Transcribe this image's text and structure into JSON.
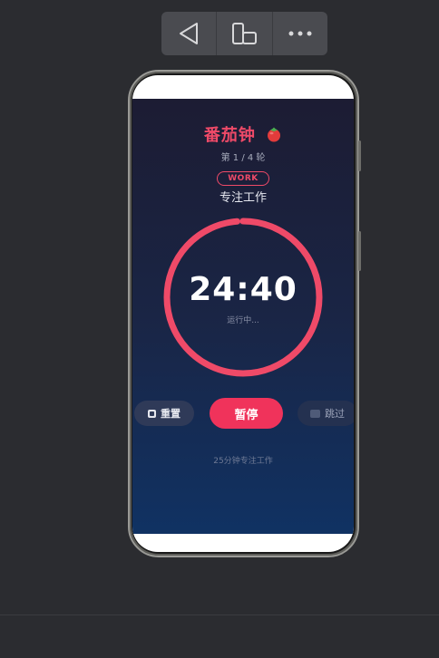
{
  "toolbar": {
    "buttons": [
      {
        "icon": "back-triangle-icon"
      },
      {
        "icon": "device-rotate-icon"
      },
      {
        "icon": "more-dots-icon"
      }
    ]
  },
  "app": {
    "title": "番茄钟",
    "title_icon": "tomato-icon",
    "round_label": "第 1 / 4 轮",
    "phase_badge": "WORK",
    "mode_label": "专注工作",
    "timer": "24:40",
    "status": "运行中...",
    "progress": 0.987,
    "buttons": {
      "reset": "重置",
      "pause": "暂停",
      "skip": "跳过"
    },
    "hint": "25分钟专注工作"
  },
  "colors": {
    "accent": "#f0335b",
    "ring": "#ef4a68",
    "background_top": "#1c1c33",
    "background_bottom": "#103263"
  }
}
